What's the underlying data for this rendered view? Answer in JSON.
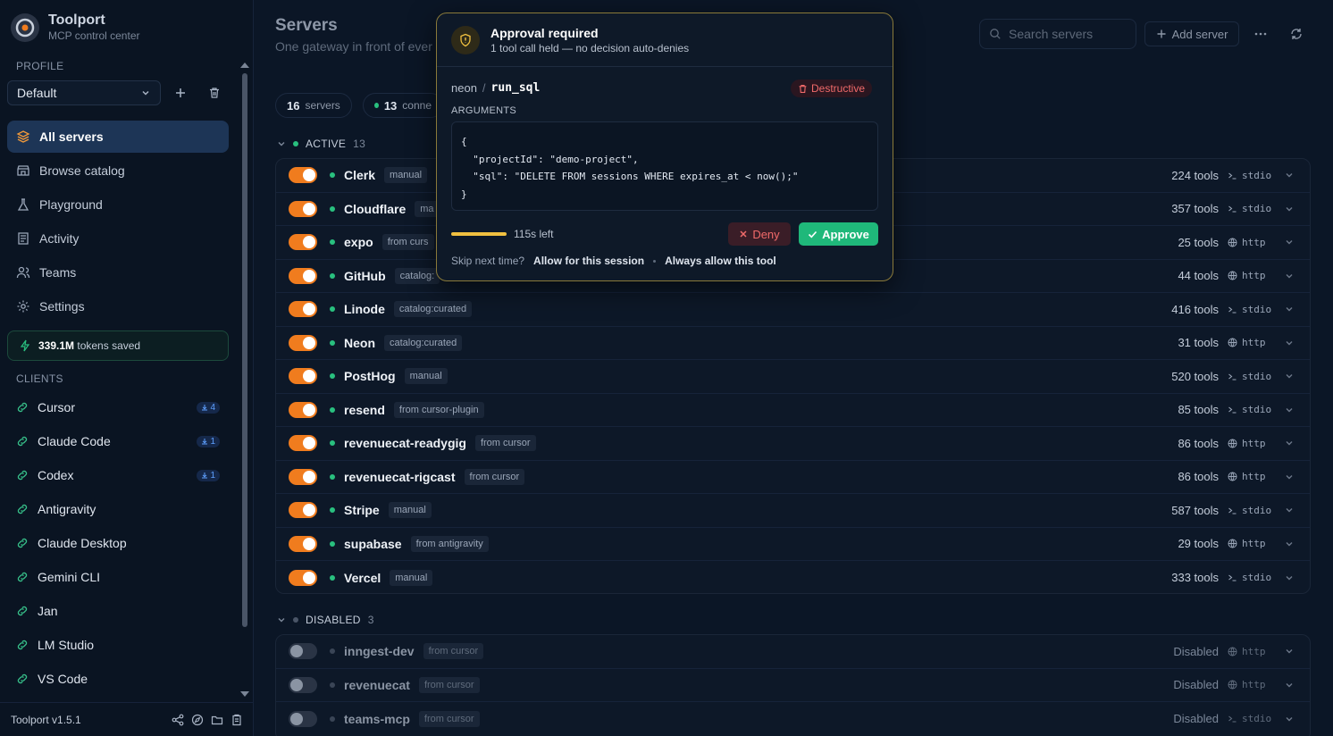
{
  "brand": {
    "title": "Toolport",
    "subtitle": "MCP control center"
  },
  "sidebar": {
    "profile_label": "PROFILE",
    "profile_value": "Default",
    "nav": [
      {
        "label": "All servers",
        "icon": "layers-icon",
        "active": true
      },
      {
        "label": "Browse catalog",
        "icon": "store-icon"
      },
      {
        "label": "Playground",
        "icon": "flask-icon"
      },
      {
        "label": "Activity",
        "icon": "activity-log-icon"
      },
      {
        "label": "Teams",
        "icon": "users-icon"
      },
      {
        "label": "Settings",
        "icon": "gear-icon"
      }
    ],
    "tokens": {
      "amount": "339.1M",
      "label": "tokens saved"
    },
    "clients_label": "CLIENTS",
    "clients": [
      {
        "name": "Cursor",
        "badge": "4"
      },
      {
        "name": "Claude Code",
        "badge": "1"
      },
      {
        "name": "Codex",
        "badge": "1"
      },
      {
        "name": "Antigravity",
        "badge": ""
      },
      {
        "name": "Claude Desktop",
        "badge": ""
      },
      {
        "name": "Gemini CLI",
        "badge": ""
      },
      {
        "name": "Jan",
        "badge": ""
      },
      {
        "name": "LM Studio",
        "badge": ""
      },
      {
        "name": "VS Code",
        "badge": ""
      }
    ],
    "version": "Toolport v1.5.1"
  },
  "header": {
    "title": "Servers",
    "subtitle": "One gateway in front of ever",
    "search_placeholder": "Search servers",
    "add_label": "Add server"
  },
  "stats": {
    "servers_count": "16",
    "servers_label": "servers",
    "connected_count": "13",
    "connected_label": "conne"
  },
  "groups": {
    "active": {
      "label": "ACTIVE",
      "count": "13"
    },
    "disabled": {
      "label": "DISABLED",
      "count": "3"
    }
  },
  "active_servers": [
    {
      "name": "Clerk",
      "tag": "manual",
      "tools": "224 tools",
      "transport": "stdio"
    },
    {
      "name": "Cloudflare",
      "tag": "ma",
      "tools": "357 tools",
      "transport": "stdio"
    },
    {
      "name": "expo",
      "tag": "from curs",
      "tools": "25 tools",
      "transport": "http"
    },
    {
      "name": "GitHub",
      "tag": "catalog:",
      "tools": "44 tools",
      "transport": "http"
    },
    {
      "name": "Linode",
      "tag": "catalog:curated",
      "tools": "416 tools",
      "transport": "stdio"
    },
    {
      "name": "Neon",
      "tag": "catalog:curated",
      "tools": "31 tools",
      "transport": "http"
    },
    {
      "name": "PostHog",
      "tag": "manual",
      "tools": "520 tools",
      "transport": "stdio"
    },
    {
      "name": "resend",
      "tag": "from cursor-plugin",
      "tools": "85 tools",
      "transport": "stdio"
    },
    {
      "name": "revenuecat-readygig",
      "tag": "from cursor",
      "tools": "86 tools",
      "transport": "http"
    },
    {
      "name": "revenuecat-rigcast",
      "tag": "from cursor",
      "tools": "86 tools",
      "transport": "http"
    },
    {
      "name": "Stripe",
      "tag": "manual",
      "tools": "587 tools",
      "transport": "stdio"
    },
    {
      "name": "supabase",
      "tag": "from antigravity",
      "tools": "29 tools",
      "transport": "http"
    },
    {
      "name": "Vercel",
      "tag": "manual",
      "tools": "333 tools",
      "transport": "stdio"
    }
  ],
  "disabled_servers": [
    {
      "name": "inngest-dev",
      "tag": "from cursor",
      "tools": "Disabled",
      "transport": "http"
    },
    {
      "name": "revenuecat",
      "tag": "from cursor",
      "tools": "Disabled",
      "transport": "http"
    },
    {
      "name": "teams-mcp",
      "tag": "from cursor",
      "tools": "Disabled",
      "transport": "stdio"
    }
  ],
  "modal": {
    "title": "Approval required",
    "subtitle": "1 tool call held — no decision auto-denies",
    "server": "neon",
    "separator": "/",
    "tool": "run_sql",
    "destructive_label": "Destructive",
    "arguments_label": "ARGUMENTS",
    "arguments_code": "{\n  \"projectId\": \"demo-project\",\n  \"sql\": \"DELETE FROM sessions WHERE expires_at < now();\"\n}",
    "time_left": "115s left",
    "time_fraction": 1.0,
    "deny_label": "Deny",
    "approve_label": "Approve",
    "skip_label": "Skip next time?",
    "allow_session": "Allow for this session",
    "always_allow": "Always allow this tool"
  },
  "colors": {
    "accent": "#f07c1e",
    "success": "#1fb87a",
    "danger": "#f06a6a",
    "warning": "#f0c040"
  }
}
